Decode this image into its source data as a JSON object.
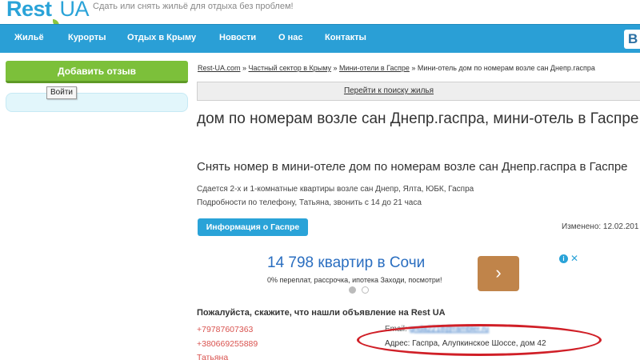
{
  "header": {
    "logo_rest": "Rest",
    "logo_dot": "·",
    "logo_ua": "UA",
    "tagline": "Сдать или снять жильё для отдыха без проблем!"
  },
  "nav": {
    "items": [
      "Жильё",
      "Курорты",
      "Отдых в Крыму",
      "Новости",
      "О нас",
      "Контакты"
    ],
    "vk_icon": "vk-icon",
    "vk_label": "В"
  },
  "sidebar": {
    "add_review_label": "Добавить отзыв",
    "login_tooltip": "Войти"
  },
  "breadcrumb": {
    "items": [
      "Rest-UA.com",
      "Частный сектор в Крыму",
      "Мини-отели в Гаспре"
    ],
    "separator": " » ",
    "current": "Мини-отель дом по номерам возле сан Днепр.гаспра"
  },
  "search_link": "Перейти к поиску жилья",
  "listing": {
    "title": "дом по номерам возле сан Днепр.гаспра, мини-отель в Гаспре",
    "subtitle": "Снять номер в мини-отеле дом по номерам возле сан Днепр.гаспра в Гаспре",
    "desc1": "Сдается 2-х и 1-комнатные квартиры возле сан Днепр, Ялта, ЮБК, Гаспра",
    "desc2": "Подробности по телефону, Татьяна, звонить с 14 до 21 часа",
    "info_button": "Информация о Гаспре",
    "changed": "Изменено: 12.02.201"
  },
  "ad": {
    "title": "14 798 квартир в Сочи",
    "subtitle": "0% переплат, рассрочка, ипотека Заходи, посмотри!",
    "arrow": "›",
    "info_icon": "info-icon",
    "close_icon": "close-icon",
    "info_glyph": "i",
    "close_glyph": "✕"
  },
  "contacts": {
    "heading": "Пожалуйста, скажите, что нашли объявление на Rest UA",
    "phone1": "+79787607363",
    "phone2": "+380669255889",
    "name": "Татьяна",
    "email_label": "Email:",
    "email_value": "gnda2218@rambler.ru",
    "address": "Адрес: Гаспра, Алупкинское Шоссе, дом 42"
  },
  "colors": {
    "brand_blue": "#2a9fd6",
    "green": "#7cc03a",
    "phone_red": "#d9534f",
    "annotation_red": "#d01f27"
  }
}
